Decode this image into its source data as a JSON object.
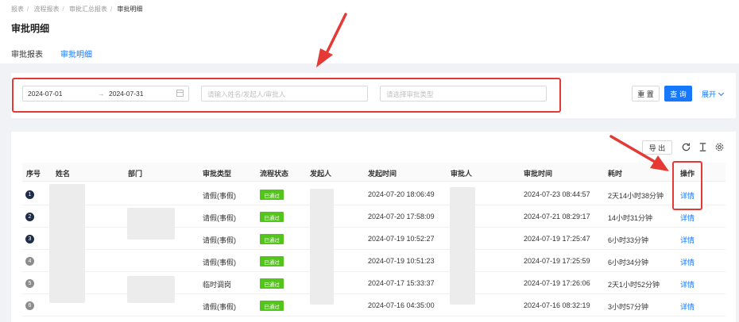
{
  "breadcrumb": [
    "报表",
    "流程报表",
    "审批汇总报表",
    "审批明细"
  ],
  "page_title": "审批明细",
  "tabs": [
    {
      "label": "审批报表",
      "active": false
    },
    {
      "label": "审批明细",
      "active": true
    }
  ],
  "filters": {
    "start_date": "2024-07-01",
    "range_sep": "→",
    "end_date": "2024-07-31",
    "name_placeholder": "请输入姓名/发起人/审批人",
    "type_placeholder": "请选择审批类型",
    "reset_label": "重 置",
    "query_label": "查 询",
    "expand_label": "展开"
  },
  "toolbar": {
    "export_label": "导 出"
  },
  "columns": [
    "序号",
    "姓名",
    "部门",
    "审批类型",
    "流程状态",
    "发起人",
    "发起时间",
    "审批人",
    "审批时间",
    "耗时",
    "操作"
  ],
  "rows": [
    {
      "index": "1",
      "type": "请假(事假)",
      "status": "已通过",
      "start": "2024-07-20 18:06:49",
      "approve": "2024-07-23 08:44:57",
      "duration": "2天14小时38分钟",
      "action": "详情"
    },
    {
      "index": "2",
      "type": "请假(事假)",
      "status": "已通过",
      "start": "2024-07-20 17:58:09",
      "approve": "2024-07-21 08:29:17",
      "duration": "14小时31分钟",
      "action": "详情"
    },
    {
      "index": "3",
      "type": "请假(事假)",
      "status": "已通过",
      "start": "2024-07-19 10:52:27",
      "approve": "2024-07-19 17:25:47",
      "duration": "6小时33分钟",
      "action": "详情"
    },
    {
      "index": "4",
      "type": "请假(事假)",
      "status": "已通过",
      "start": "2024-07-19 10:51:23",
      "approve": "2024-07-19 17:25:59",
      "duration": "6小时34分钟",
      "action": "详情"
    },
    {
      "index": "5",
      "type": "临时调岗",
      "status": "已通过",
      "start": "2024-07-17 15:33:37",
      "approve": "2024-07-19 17:26:06",
      "duration": "2天1小时52分钟",
      "action": "详情"
    },
    {
      "index": "6",
      "type": "请假(事假)",
      "status": "已通过",
      "start": "2024-07-16 04:35:00",
      "approve": "2024-07-16 08:32:19",
      "duration": "3小时57分钟",
      "action": "详情"
    }
  ],
  "colors": {
    "accent": "#1677ff",
    "success": "#52c41a",
    "highlight": "#e53935",
    "index_dark": "#1f2d4a",
    "index_gray": "#8c8c8c"
  },
  "icons": [
    "calendar-icon",
    "chevron-down-icon",
    "refresh-icon",
    "column-height-icon",
    "settings-icon"
  ]
}
